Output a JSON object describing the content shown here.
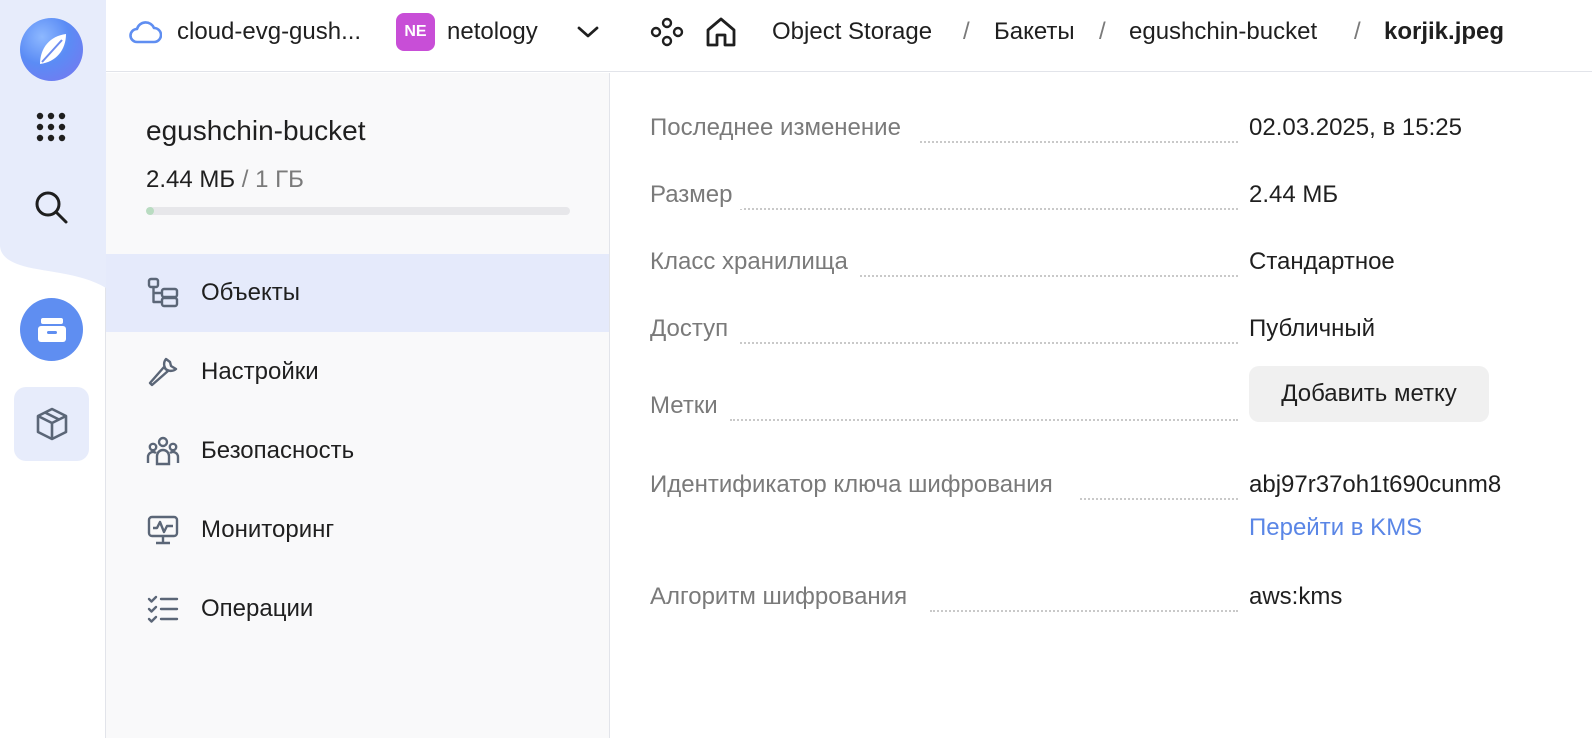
{
  "header": {
    "cloud_name": "cloud-evg-gush...",
    "org_badge": "NE",
    "org_name": "netology",
    "breadcrumbs": [
      "Object Storage",
      "Бакеты",
      "egushchin-bucket",
      "korjik.jpeg"
    ],
    "separator": "/"
  },
  "rail": {
    "icons": [
      "app-logo",
      "services-grid-icon",
      "search-icon",
      "object-storage-icon",
      "box-icon"
    ]
  },
  "sidebar": {
    "bucket_name": "egushchin-bucket",
    "used": "2.44 МБ",
    "total": "/ 1 ГБ",
    "usage_fraction": 0.0024,
    "items": [
      {
        "label": "Объекты",
        "icon": "objects-tree-icon",
        "active": true
      },
      {
        "label": "Настройки",
        "icon": "wrench-icon",
        "active": false
      },
      {
        "label": "Безопасность",
        "icon": "users-icon",
        "active": false
      },
      {
        "label": "Мониторинг",
        "icon": "monitor-chart-icon",
        "active": false
      },
      {
        "label": "Операции",
        "icon": "checklist-icon",
        "active": false
      }
    ]
  },
  "details": {
    "rows": [
      {
        "label": "Последнее изменение",
        "value": "02.03.2025, в 15:25"
      },
      {
        "label": "Размер",
        "value": "2.44 МБ"
      },
      {
        "label": "Класс хранилища",
        "value": "Стандартное"
      },
      {
        "label": "Доступ",
        "value": "Публичный"
      },
      {
        "label": "Метки",
        "button": "Добавить метку"
      },
      {
        "label": "Идентификатор ключа шифрования",
        "value": "abj97r37oh1t690cunm8",
        "link": "Перейти в KMS"
      },
      {
        "label": "Алгоритм шифрования",
        "value": "aws:kms"
      }
    ]
  },
  "colors": {
    "accent": "#5f8ef1",
    "active_bg": "#e5eafb",
    "link": "#5a86e6",
    "org_badge": "#c84ed7"
  }
}
